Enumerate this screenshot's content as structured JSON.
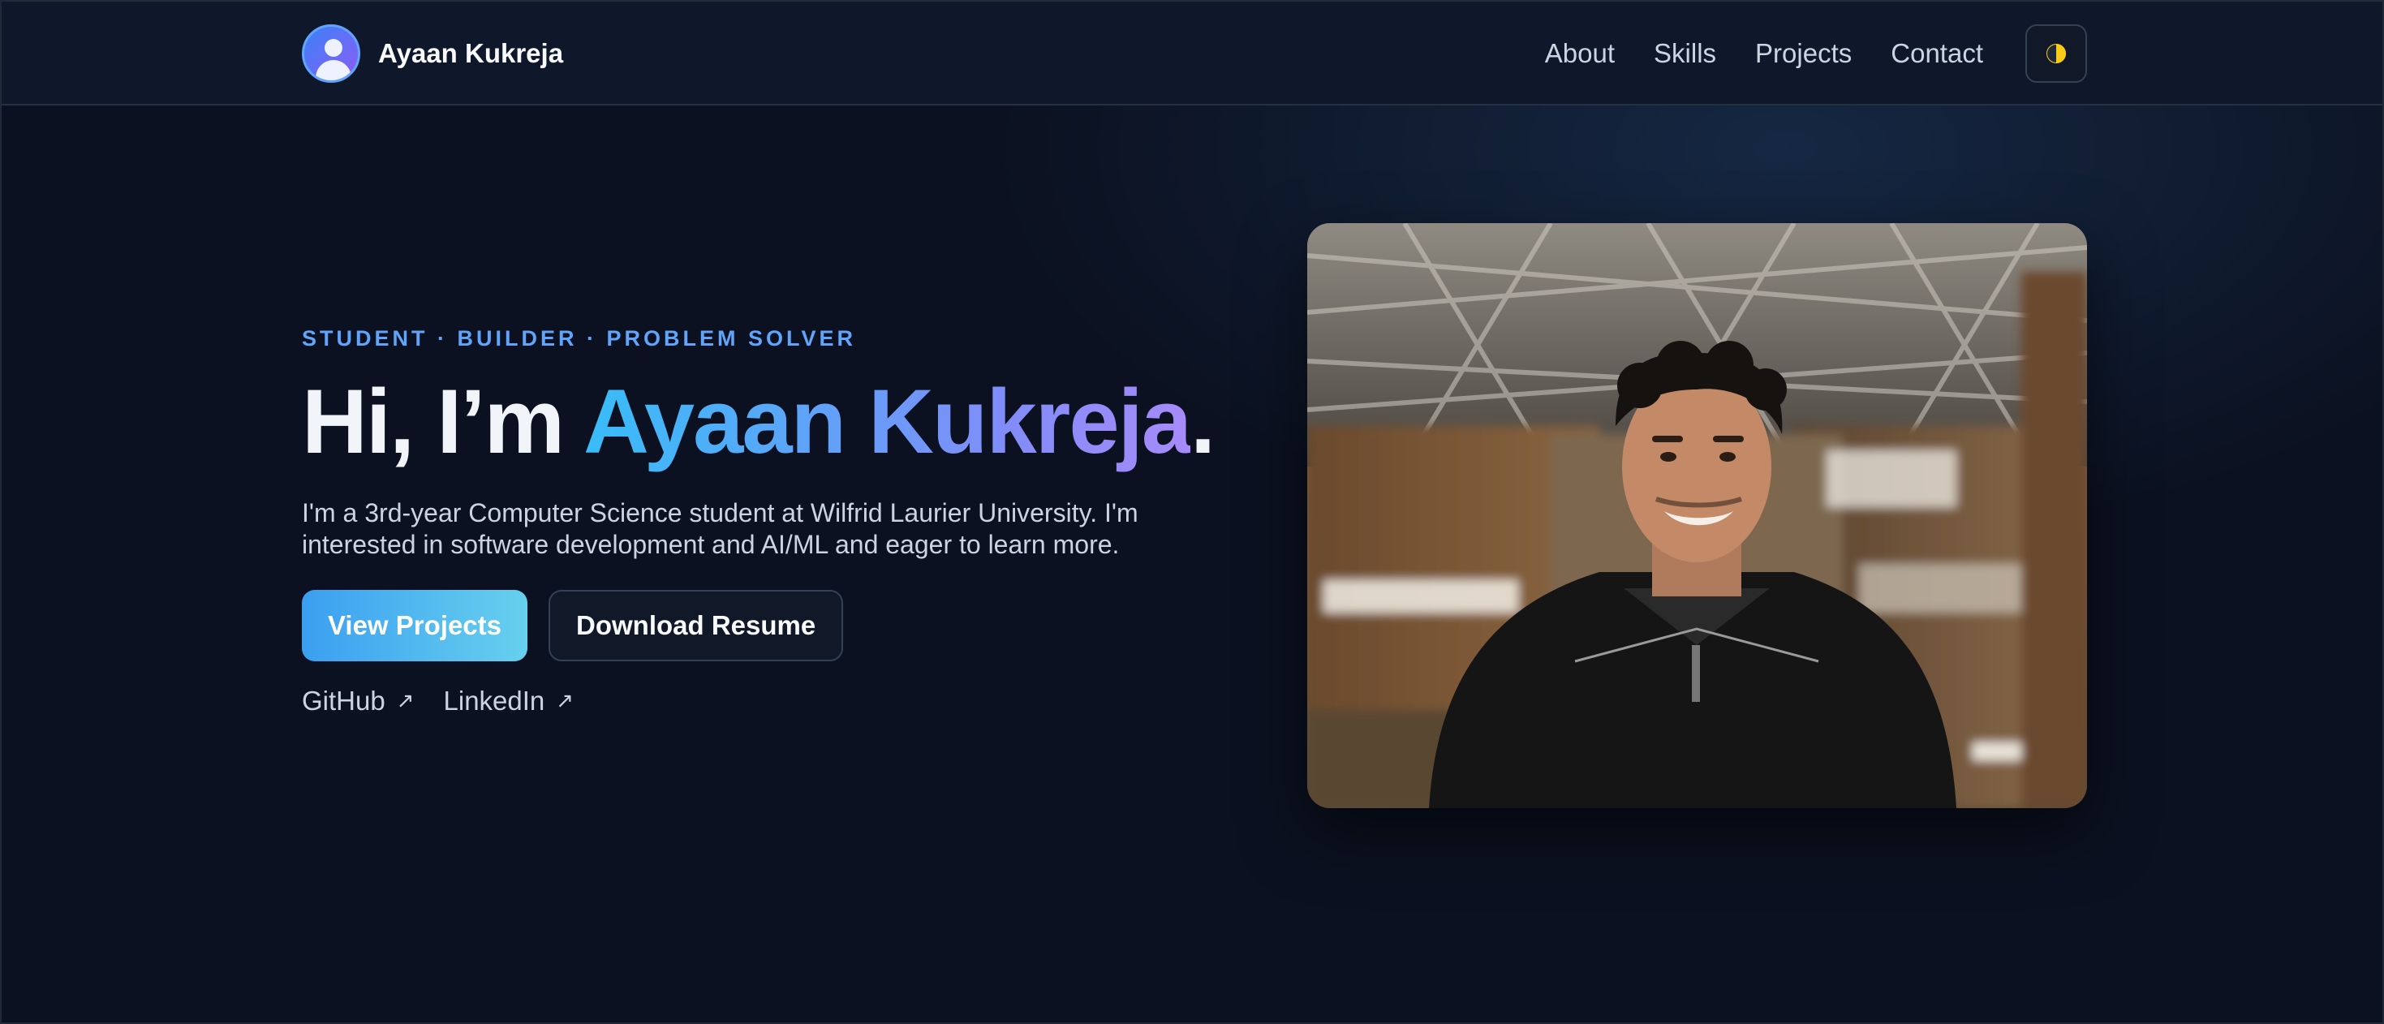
{
  "nav": {
    "brand": "Ayaan Kukreja",
    "links": [
      "About",
      "Skills",
      "Projects",
      "Contact"
    ]
  },
  "hero": {
    "tagline": "STUDENT · BUILDER · PROBLEM SOLVER",
    "headline_prefix": "Hi, I’m ",
    "headline_name": "Ayaan Kukreja",
    "headline_suffix": ".",
    "bio": "I'm a 3rd-year Computer Science student at Wilfrid Laurier University. I'm interested in software development and AI/ML and eager to learn more.",
    "primary_button": "View Projects",
    "secondary_button": "Download Resume",
    "social": [
      "GitHub",
      "LinkedIn"
    ],
    "arrow": "↗"
  },
  "colors": {
    "background": "#0b1120",
    "accent": "#60a5fa",
    "gradient_start": "#38bdf8",
    "gradient_end": "#a78bfa"
  },
  "icons": {
    "avatar": "person-avatar-icon",
    "theme_toggle": "half-moon-icon",
    "external_link": "arrow-up-right-icon"
  }
}
